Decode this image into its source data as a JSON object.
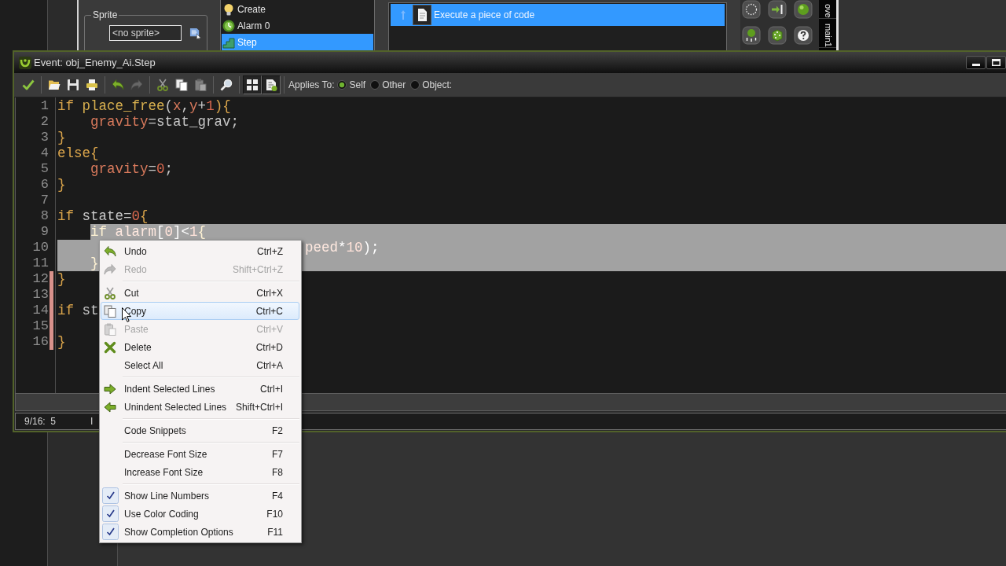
{
  "object_window": {
    "sprite": {
      "label": "Sprite",
      "value": "<no sprite>"
    },
    "events": [
      {
        "label": "Create",
        "selected": false
      },
      {
        "label": "Alarm 0",
        "selected": false
      },
      {
        "label": "Step",
        "selected": true
      }
    ],
    "actions": [
      {
        "label": "Execute a piece of code",
        "selected": true
      }
    ],
    "library_tabs": [
      "ove",
      "main1"
    ]
  },
  "event_window": {
    "title": "Event: obj_Enemy_Ai.Step",
    "toolbar": {
      "buttons": [
        {
          "disabled": false,
          "pressed": false
        },
        {
          "disabled": false,
          "pressed": false
        },
        {
          "disabled": false,
          "pressed": false
        },
        {
          "disabled": false,
          "pressed": false
        },
        {
          "disabled": false,
          "pressed": false
        },
        {
          "disabled": true,
          "pressed": false
        },
        {
          "disabled": false,
          "pressed": false
        },
        {
          "disabled": false,
          "pressed": false
        },
        {
          "disabled": true,
          "pressed": false
        },
        {
          "disabled": false,
          "pressed": false
        },
        {
          "disabled": false,
          "pressed": true
        },
        {
          "disabled": false,
          "pressed": true
        }
      ],
      "applies_to": {
        "label": "Applies To:",
        "options": [
          {
            "label": "Self",
            "selected": true
          },
          {
            "label": "Other",
            "selected": false
          },
          {
            "label": "Object:",
            "selected": false
          }
        ]
      }
    },
    "editor": {
      "lines": [
        {
          "number": "1",
          "selected": false,
          "changed": false,
          "tokens": [
            {
              "text": "if",
              "kind": "keyword"
            },
            {
              "text": " place_free",
              "kind": "function"
            },
            {
              "text": "(",
              "kind": "plain"
            },
            {
              "text": "x",
              "kind": "builtin"
            },
            {
              "text": ",",
              "kind": "plain"
            },
            {
              "text": "y",
              "kind": "builtin"
            },
            {
              "text": "+",
              "kind": "plain"
            },
            {
              "text": "1",
              "kind": "number"
            },
            {
              "text": "){",
              "kind": "keyword"
            }
          ]
        },
        {
          "number": "2",
          "selected": false,
          "changed": false,
          "tokens": [
            {
              "text": "    gravity",
              "kind": "builtin"
            },
            {
              "text": "=stat_grav;",
              "kind": "plain"
            }
          ]
        },
        {
          "number": "3",
          "selected": false,
          "changed": false,
          "tokens": [
            {
              "text": "}",
              "kind": "keyword"
            }
          ]
        },
        {
          "number": "4",
          "selected": false,
          "changed": false,
          "tokens": [
            {
              "text": "else{",
              "kind": "keyword"
            }
          ]
        },
        {
          "number": "5",
          "selected": false,
          "changed": false,
          "tokens": [
            {
              "text": "    gravity",
              "kind": "builtin"
            },
            {
              "text": "=",
              "kind": "plain"
            },
            {
              "text": "0",
              "kind": "number"
            },
            {
              "text": ";",
              "kind": "plain"
            }
          ]
        },
        {
          "number": "6",
          "selected": false,
          "changed": false,
          "tokens": [
            {
              "text": "}",
              "kind": "keyword"
            }
          ]
        },
        {
          "number": "7",
          "selected": false,
          "changed": false
        },
        {
          "number": "8",
          "selected": false,
          "changed": false,
          "tokens": [
            {
              "text": "if",
              "kind": "keyword"
            },
            {
              "text": " state=",
              "kind": "plain"
            },
            {
              "text": "0",
              "kind": "number"
            },
            {
              "text": "{",
              "kind": "keyword"
            }
          ]
        },
        {
          "number": "9",
          "selected": true,
          "changed": false,
          "tokens": [
            {
              "text": "    if",
              "kind": "keyword"
            },
            {
              "text": " alarm",
              "kind": "builtin"
            },
            {
              "text": "[",
              "kind": "plain"
            },
            {
              "text": "0",
              "kind": "number"
            },
            {
              "text": "]<",
              "kind": "plain"
            },
            {
              "text": "1",
              "kind": "number"
            },
            {
              "text": "{",
              "kind": "keyword"
            }
          ]
        },
        {
          "number": "10",
          "selected": true,
          "changed": false,
          "tokens": [
            {
              "text": "                              peed",
              "kind": "builtin"
            },
            {
              "text": "*",
              "kind": "plain"
            },
            {
              "text": "10",
              "kind": "number"
            },
            {
              "text": ");",
              "kind": "plain"
            }
          ]
        },
        {
          "number": "11",
          "selected": true,
          "changed": false,
          "tokens": [
            {
              "text": "    }",
              "kind": "keyword"
            }
          ]
        },
        {
          "number": "12",
          "selected": false,
          "changed": true,
          "tokens": [
            {
              "text": "}",
              "kind": "keyword"
            }
          ]
        },
        {
          "number": "13",
          "selected": false,
          "changed": true
        },
        {
          "number": "14",
          "selected": false,
          "changed": true,
          "tokens": [
            {
              "text": "if",
              "kind": "keyword"
            },
            {
              "text": " st",
              "kind": "plain"
            }
          ]
        },
        {
          "number": "15",
          "selected": false,
          "changed": true
        },
        {
          "number": "16",
          "selected": false,
          "changed": true,
          "tokens": [
            {
              "text": "}",
              "kind": "keyword"
            }
          ]
        }
      ]
    },
    "status_bar": {
      "position": "9/16:  5",
      "indicator": "I"
    }
  },
  "context_menu": {
    "groups": [
      [
        {
          "label": "Undo",
          "shortcut": "Ctrl+Z",
          "disabled": false,
          "selected": false,
          "checked": false
        },
        {
          "label": "Redo",
          "shortcut": "Shift+Ctrl+Z",
          "disabled": true,
          "selected": false,
          "checked": false
        }
      ],
      [
        {
          "label": "Cut",
          "shortcut": "Ctrl+X",
          "disabled": false,
          "selected": false,
          "checked": false
        },
        {
          "label": "Copy",
          "shortcut": "Ctrl+C",
          "disabled": false,
          "selected": true,
          "checked": false
        },
        {
          "label": "Paste",
          "shortcut": "Ctrl+V",
          "disabled": true,
          "selected": false,
          "checked": false
        },
        {
          "label": "Delete",
          "shortcut": "Ctrl+D",
          "disabled": false,
          "selected": false,
          "checked": false
        },
        {
          "label": "Select All",
          "shortcut": "Ctrl+A",
          "disabled": false,
          "selected": false,
          "checked": false
        }
      ],
      [
        {
          "label": "Indent Selected Lines",
          "shortcut": "Ctrl+I",
          "disabled": false,
          "selected": false,
          "checked": false
        },
        {
          "label": "Unindent Selected Lines",
          "shortcut": "Shift+Ctrl+I",
          "disabled": false,
          "selected": false,
          "checked": false
        }
      ],
      [
        {
          "label": "Code Snippets",
          "shortcut": "F2",
          "disabled": false,
          "selected": false,
          "checked": false
        }
      ],
      [
        {
          "label": "Decrease Font Size",
          "shortcut": "F7",
          "disabled": false,
          "selected": false,
          "checked": false
        },
        {
          "label": "Increase Font Size",
          "shortcut": "F8",
          "disabled": false,
          "selected": false,
          "checked": false
        }
      ],
      [
        {
          "label": "Show Line Numbers",
          "shortcut": "F4",
          "disabled": false,
          "selected": false,
          "checked": true
        },
        {
          "label": "Use Color Coding",
          "shortcut": "F10",
          "disabled": false,
          "selected": false,
          "checked": true
        },
        {
          "label": "Show Completion Options",
          "shortcut": "F11",
          "disabled": false,
          "selected": false,
          "checked": true
        }
      ]
    ]
  }
}
